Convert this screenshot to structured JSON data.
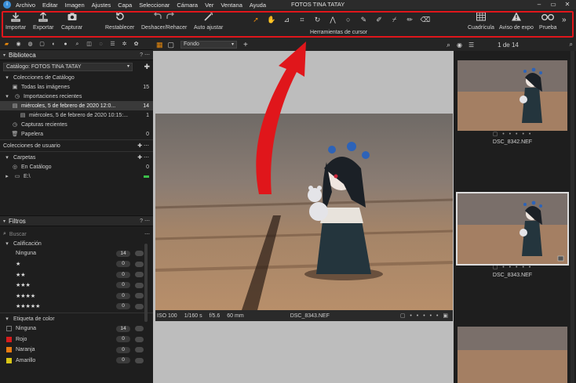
{
  "app": {
    "menu": [
      "Archivo",
      "Editar",
      "Imagen",
      "Ajustes",
      "Capa",
      "Seleccionar",
      "Cámara",
      "Ver",
      "Ventana",
      "Ayuda"
    ],
    "window_title": "FOTOS TINA TATAY"
  },
  "toolbar": {
    "import": "Importar",
    "export": "Exportar",
    "capture": "Capturar",
    "reset": "Restablecer",
    "undo_redo": "Deshacer/Rehacer",
    "auto_adjust": "Auto ajustar",
    "cursor_tools": "Herramientas de cursor",
    "grid": "Cuadrícula",
    "exposure_warning": "Aviso de expo",
    "proof": "Prueba",
    "more": "»"
  },
  "library": {
    "title": "Biblioteca",
    "catalog": "Catálogo: FOTOS TINA TATAY",
    "catalog_collections": "Colecciones de Catálogo",
    "all_images": "Todas las imágenes",
    "all_images_count": "15",
    "recent_imports": "Importaciones recientes",
    "import_1": "miércoles, 5 de febrero de 2020 12:0...",
    "import_1_count": "14",
    "import_2": "miércoles, 5 de febrero de 2020 10:15:...",
    "import_2_count": "1",
    "recent_captures": "Capturas recientes",
    "trash": "Papelera",
    "trash_count": "0",
    "user_collections": "Colecciones de usuario",
    "folders": "Carpetas",
    "in_catalog": "En Catálogo",
    "in_catalog_count": "0",
    "drive": "E:\\"
  },
  "filters": {
    "title": "Filtros",
    "search_placeholder": "Buscar",
    "rating_title": "Calificación",
    "ratings": [
      {
        "label": "Ninguna",
        "count": "14"
      },
      {
        "label": "★",
        "count": "0"
      },
      {
        "label": "★★",
        "count": "0"
      },
      {
        "label": "★★★",
        "count": "0"
      },
      {
        "label": "★★★★",
        "count": "0"
      },
      {
        "label": "★★★★★",
        "count": "0"
      }
    ],
    "color_title": "Etiqueta de color",
    "colors": [
      {
        "label": "Ninguna",
        "count": "14",
        "color": "#1e1e1e"
      },
      {
        "label": "Rojo",
        "count": "0",
        "color": "#d61c1c"
      },
      {
        "label": "Naranja",
        "count": "0",
        "color": "#e87a12"
      },
      {
        "label": "Amarillo",
        "count": "0",
        "color": "#d8c516"
      }
    ]
  },
  "viewer": {
    "background_select": "Fondo",
    "iso": "ISO 100",
    "shutter": "1/160 s",
    "aperture": "f/5.6",
    "focal": "60 mm",
    "filename": "DSC_8343.NEF"
  },
  "browser": {
    "counter": "1 de 14",
    "thumbs": [
      {
        "name": "DSC_8342.NEF"
      },
      {
        "name": "DSC_8343.NEF"
      }
    ]
  },
  "colors": {
    "highlight": "#e0161b",
    "accent": "#e8890c"
  }
}
